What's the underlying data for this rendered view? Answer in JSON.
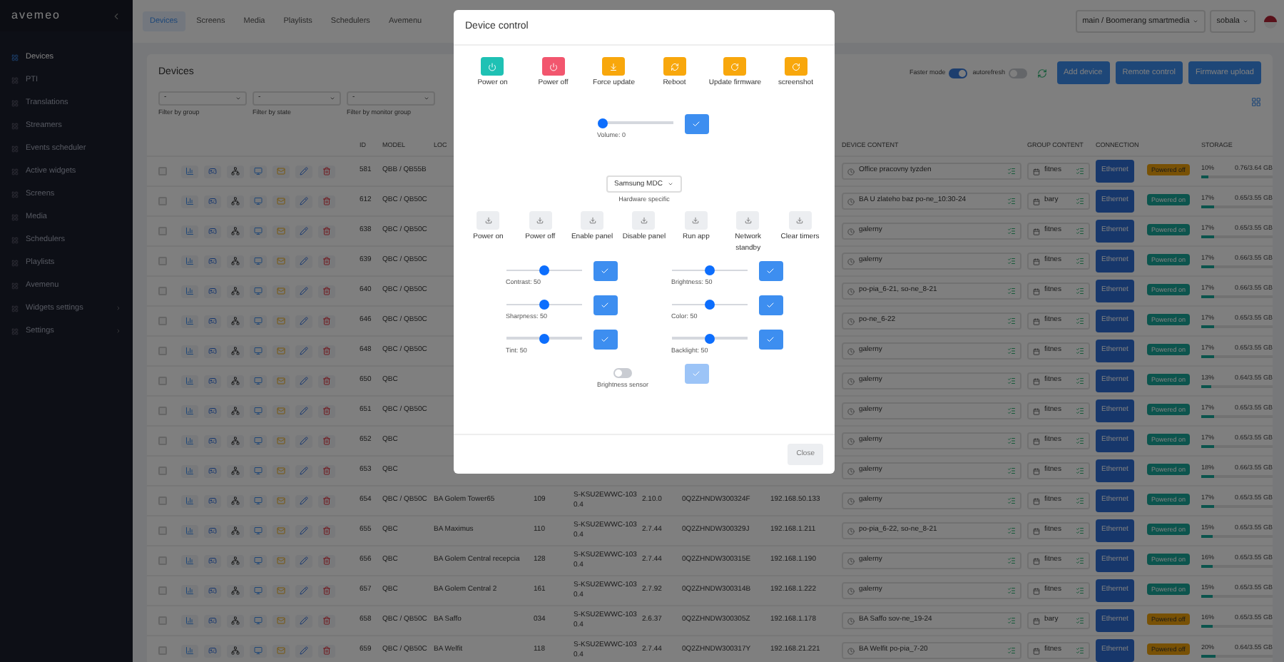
{
  "sidebar": {
    "logo": "avemeo",
    "items": [
      {
        "label": "Devices",
        "selected": true,
        "expandable": false
      },
      {
        "label": "PTI",
        "selected": false,
        "expandable": false
      },
      {
        "label": "Translations",
        "selected": false,
        "expandable": false
      },
      {
        "label": "Streamers",
        "selected": false,
        "expandable": false
      },
      {
        "label": "Events scheduler",
        "selected": false,
        "expandable": false
      },
      {
        "label": "Active widgets",
        "selected": false,
        "expandable": false
      },
      {
        "label": "Screens",
        "selected": false,
        "expandable": false
      },
      {
        "label": "Media",
        "selected": false,
        "expandable": false
      },
      {
        "label": "Schedulers",
        "selected": false,
        "expandable": false
      },
      {
        "label": "Playlists",
        "selected": false,
        "expandable": false
      },
      {
        "label": "Avemenu",
        "selected": false,
        "expandable": false
      },
      {
        "label": "Widgets settings",
        "selected": false,
        "expandable": true
      },
      {
        "label": "Settings",
        "selected": false,
        "expandable": true
      }
    ]
  },
  "top_nav": {
    "tabs": [
      {
        "label": "Devices",
        "selected": true
      },
      {
        "label": "Screens",
        "selected": false
      },
      {
        "label": "Media",
        "selected": false
      },
      {
        "label": "Playlists",
        "selected": false
      },
      {
        "label": "Schedulers",
        "selected": false
      },
      {
        "label": "Avemenu",
        "selected": false
      }
    ],
    "account": "main / Boomerang smartmedia",
    "user": "sobala"
  },
  "devices_card": {
    "title": "Devices",
    "toggles": [
      {
        "label": "Faster mode",
        "on": true
      },
      {
        "label": "autorefresh",
        "on": false
      }
    ],
    "buttons": [
      "Add device",
      "Remote control",
      "Firmware upload"
    ],
    "filters": [
      {
        "value": "-",
        "label": "Filter by group"
      },
      {
        "value": "-",
        "label": "Filter by state"
      },
      {
        "value": "-",
        "label": "Filter by monitor group"
      }
    ]
  },
  "table": {
    "header": {
      "id": "ID",
      "model": "MODEL",
      "location": "LOC",
      "device_content": "DEVICE CONTENT",
      "group_content": "GROUP CONTENT",
      "connection": "CONNECTION",
      "storage": "STORAGE"
    },
    "rows": [
      {
        "checked": false,
        "id": "581",
        "model": "QBB / QB55B",
        "device_content": "Office pracovny tyzden",
        "group_content": "fitnes",
        "connection": "Ethernet",
        "status": {
          "label": "Powered off",
          "on": false
        },
        "storage_percent": "10%",
        "storage_usage": "0.76/3.64 GB",
        "level": 0.1
      },
      {
        "checked": false,
        "id": "612",
        "model": "QBC / QB50C",
        "device_content": "BA U zlateho baz po-ne_10:30-24",
        "group_content": "bary",
        "connection": "Ethernet",
        "status": {
          "label": "Powered on",
          "on": true
        },
        "storage_percent": "17%",
        "storage_usage": "0.65/3.55 GB",
        "level": 0.17
      },
      {
        "checked": false,
        "id": "638",
        "model": "QBC / QB50C",
        "device_content": "galerny",
        "group_content": "fitnes",
        "connection": "Ethernet",
        "status": {
          "label": "Powered on",
          "on": true
        },
        "storage_percent": "17%",
        "storage_usage": "0.65/3.55 GB",
        "level": 0.17
      },
      {
        "checked": false,
        "id": "639",
        "model": "QBC / QB50C",
        "device_content": "galerny",
        "group_content": "fitnes",
        "connection": "Ethernet",
        "status": {
          "label": "Powered on",
          "on": true
        },
        "storage_percent": "17%",
        "storage_usage": "0.66/3.55 GB",
        "level": 0.17
      },
      {
        "checked": false,
        "id": "640",
        "model": "QBC / QB50C",
        "device_content": "po-pia_6-21, so-ne_8-21",
        "group_content": "fitnes",
        "connection": "Ethernet",
        "status": {
          "label": "Powered on",
          "on": true
        },
        "storage_percent": "17%",
        "storage_usage": "0.66/3.55 GB",
        "level": 0.17
      },
      {
        "checked": false,
        "id": "646",
        "model": "QBC / QB50C",
        "device_content": "po-ne_6-22",
        "group_content": "fitnes",
        "connection": "Ethernet",
        "status": {
          "label": "Powered on",
          "on": true
        },
        "storage_percent": "17%",
        "storage_usage": "0.65/3.55 GB",
        "level": 0.17
      },
      {
        "checked": false,
        "id": "648",
        "model": "QBC / QB50C",
        "device_content": "galerny",
        "group_content": "fitnes",
        "connection": "Ethernet",
        "status": {
          "label": "Powered on",
          "on": true
        },
        "storage_percent": "17%",
        "storage_usage": "0.65/3.55 GB",
        "level": 0.17
      },
      {
        "checked": false,
        "id": "650",
        "model": "QBC",
        "device_content": "galerny",
        "group_content": "fitnes",
        "connection": "Ethernet",
        "status": {
          "label": "Powered on",
          "on": true
        },
        "storage_percent": "13%",
        "storage_usage": "0.64/3.55 GB",
        "level": 0.13
      },
      {
        "checked": false,
        "id": "651",
        "model": "QBC / QB50C",
        "device_content": "galerny",
        "group_content": "fitnes",
        "connection": "Ethernet",
        "status": {
          "label": "Powered on",
          "on": true
        },
        "storage_percent": "17%",
        "storage_usage": "0.65/3.55 GB",
        "level": 0.17
      },
      {
        "checked": false,
        "id": "652",
        "model": "QBC",
        "device_content": "galerny",
        "group_content": "fitnes",
        "connection": "Ethernet",
        "status": {
          "label": "Powered on",
          "on": true
        },
        "storage_percent": "17%",
        "storage_usage": "0.65/3.55 GB",
        "level": 0.17
      },
      {
        "checked": false,
        "id": "653",
        "model": "QBC",
        "device_content": "galerny",
        "group_content": "fitnes",
        "connection": "Ethernet",
        "status": {
          "label": "Powered on",
          "on": true
        },
        "storage_percent": "18%",
        "storage_usage": "0.66/3.55 GB",
        "level": 0.18
      },
      {
        "checked": false,
        "id": "654",
        "model": "QBC / QB50C",
        "location": "BA Golem Tower65",
        "column_6": "109",
        "firmware": "S-KSU2EWWC-1030.4",
        "version": "2.10.0",
        "serial": "0Q2ZHNDW300324F",
        "ip": "192.168.50.133",
        "device_content": "galerny",
        "group_content": "fitnes",
        "connection": "Ethernet",
        "status": {
          "label": "Powered on",
          "on": true
        },
        "storage_percent": "17%",
        "storage_usage": "0.65/3.55 GB",
        "level": 0.17
      },
      {
        "checked": false,
        "id": "655",
        "model": "QBC",
        "location": "BA Maximus",
        "column_6": "110",
        "firmware": "S-KSU2EWWC-1030.4",
        "version": "2.7.44",
        "serial": "0Q2ZHNDW300329J",
        "ip": "192.168.1.211",
        "device_content": "po-pia_6-22, so-ne_8-21",
        "group_content": "fitnes",
        "connection": "Ethernet",
        "status": {
          "label": "Powered on",
          "on": true
        },
        "storage_percent": "15%",
        "storage_usage": "0.65/3.55 GB",
        "level": 0.15
      },
      {
        "checked": false,
        "id": "656",
        "model": "QBC",
        "location": "BA Golem Central recepcia",
        "column_6": "128",
        "firmware": "S-KSU2EWWC-1030.4",
        "version": "2.7.44",
        "serial": "0Q2ZHNDW300315E",
        "ip": "192.168.1.190",
        "device_content": "galerny",
        "group_content": "fitnes",
        "connection": "Ethernet",
        "status": {
          "label": "Powered on",
          "on": true
        },
        "storage_percent": "16%",
        "storage_usage": "0.65/3.55 GB",
        "level": 0.16
      },
      {
        "checked": false,
        "id": "657",
        "model": "QBC",
        "location": "BA Golem Central 2",
        "column_6": "161",
        "firmware": "S-KSU2EWWC-1030.4",
        "version": "2.7.92",
        "serial": "0Q2ZHNDW300314B",
        "ip": "192.168.1.222",
        "device_content": "galerny",
        "group_content": "fitnes",
        "connection": "Ethernet",
        "status": {
          "label": "Powered on",
          "on": true
        },
        "storage_percent": "15%",
        "storage_usage": "0.65/3.55 GB",
        "level": 0.15
      },
      {
        "checked": false,
        "id": "658",
        "model": "QBC / QB50C",
        "location": "BA Saffo",
        "column_6": "034",
        "firmware": "S-KSU2EWWC-1030.4",
        "version": "2.6.37",
        "serial": "0Q2ZHNDW300305Z",
        "ip": "192.168.1.178",
        "device_content": "BA Saffo sov-ne_19-24",
        "group_content": "bary",
        "connection": "Ethernet",
        "status": {
          "label": "Powered off",
          "on": false
        },
        "storage_percent": "16%",
        "storage_usage": "0.65/3.55 GB",
        "level": 0.16
      },
      {
        "checked": false,
        "id": "659",
        "model": "QBC / QB50C",
        "location": "BA Welfit",
        "column_6": "118",
        "firmware": "S-KSU2EWWC-1030.4",
        "version": "2.7.44",
        "serial": "0Q2ZHNDW300317Y",
        "ip": "192.168.21.221",
        "device_content": "BA Welfit po-pia_7-20",
        "group_content": "fitnes",
        "connection": "Ethernet",
        "status": {
          "label": "Powered off",
          "on": false
        },
        "storage_percent": "20%",
        "storage_usage": "0.64/3.55 GB",
        "level": 0.2
      }
    ]
  },
  "modal": {
    "title": "Device control",
    "actions": [
      {
        "label": "Power on",
        "kind": "power",
        "color": "#1fc1b4"
      },
      {
        "label": "Power off",
        "kind": "power",
        "color": "#f2566e"
      },
      {
        "label": "Force update",
        "kind": "update",
        "color": "#f8a70c"
      },
      {
        "label": "Reboot",
        "kind": "reboot",
        "color": "#f8a70c"
      },
      {
        "label": "Update firmware",
        "kind": "refresh",
        "color": "#f8a70c"
      },
      {
        "label": "screenshot",
        "kind": "refresh",
        "color": "#f8a70c"
      }
    ],
    "volume": {
      "label": "Volume: 0",
      "level": 0
    },
    "hardware": {
      "value": "Samsung MDC",
      "label": "Hardware specific"
    },
    "hardware_actions": [
      "Power on",
      "Power off",
      "Enable panel",
      "Disable panel",
      "Run app",
      "Network standby",
      "Clear timers"
    ],
    "sliders": [
      {
        "label": "Contrast: 50",
        "level": 0.5
      },
      {
        "label": "Brightness: 50",
        "level": 0.5
      },
      {
        "label": "Sharpness: 50",
        "level": 0.5
      },
      {
        "label": "Color: 50",
        "level": 0.5
      },
      {
        "label": "Tint: 50",
        "level": 0.5
      },
      {
        "label": "Backlight: 50",
        "level": 0.5
      }
    ],
    "brightness_sensor": {
      "label": "Brightness sensor",
      "on": false,
      "confirm_disabled": true
    },
    "close": "Close"
  }
}
